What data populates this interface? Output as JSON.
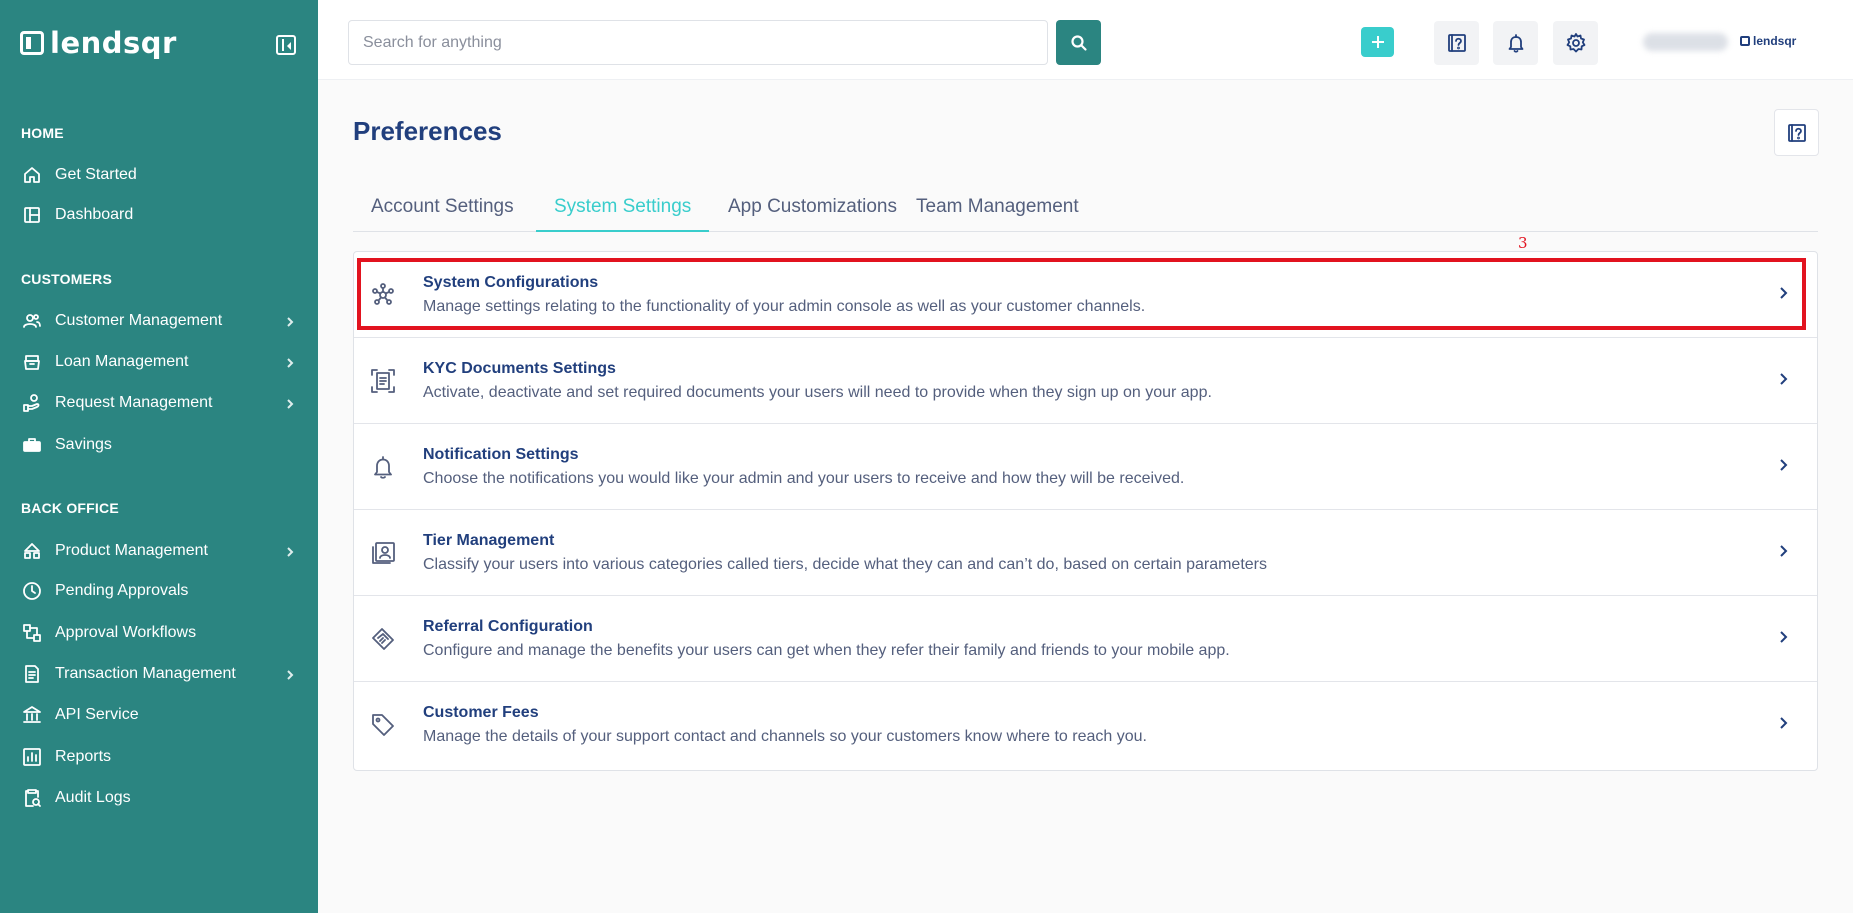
{
  "app": {
    "name": "lendsqr"
  },
  "sidebar": {
    "sections": [
      {
        "title": "HOME"
      },
      {
        "title": "CUSTOMERS"
      },
      {
        "title": "BACK OFFICE"
      }
    ],
    "items": [
      {
        "label": "Get Started",
        "icon": "home-icon"
      },
      {
        "label": "Dashboard",
        "icon": "dashboard-icon"
      },
      {
        "label": "Customer Management",
        "icon": "users-icon",
        "has_submenu": true
      },
      {
        "label": "Loan Management",
        "icon": "bank-icon",
        "has_submenu": true
      },
      {
        "label": "Request Management",
        "icon": "hand-money-icon",
        "has_submenu": true
      },
      {
        "label": "Savings",
        "icon": "briefcase-icon"
      },
      {
        "label": "Product Management",
        "icon": "product-icon",
        "has_submenu": true
      },
      {
        "label": "Pending Approvals",
        "icon": "clock-icon"
      },
      {
        "label": "Approval Workflows",
        "icon": "workflow-icon"
      },
      {
        "label": "Transaction Management",
        "icon": "transaction-icon",
        "has_submenu": true
      },
      {
        "label": "API Service",
        "icon": "bank-building-icon"
      },
      {
        "label": "Reports",
        "icon": "chart-icon"
      },
      {
        "label": "Audit Logs",
        "icon": "clipboard-search-icon"
      }
    ]
  },
  "topbar": {
    "search_placeholder": "Search for anything",
    "user_logo_text": "lendsqr"
  },
  "page": {
    "title": "Preferences",
    "tabs": [
      {
        "label": "Account Settings",
        "active": false
      },
      {
        "label": "System Settings",
        "active": true
      },
      {
        "label": "App Customizations",
        "active": false
      },
      {
        "label": "Team Management",
        "active": false
      }
    ],
    "settings": [
      {
        "title": "System Configurations",
        "description": "Manage settings relating to the functionality of your admin console as well as your customer channels.",
        "icon": "network-icon"
      },
      {
        "title": "KYC Documents Settings",
        "description": "Activate, deactivate and set required documents your users will need to provide when they sign up on your app.",
        "icon": "document-scan-icon"
      },
      {
        "title": "Notification Settings",
        "description": "Choose the notifications you would like your admin and your users to receive and how they will be received.",
        "icon": "bell-icon"
      },
      {
        "title": "Tier Management",
        "description": "Classify your users into various categories called tiers, decide what they can and can’t do, based on certain parameters",
        "icon": "user-card-icon"
      },
      {
        "title": "Referral Configuration",
        "description": "Configure and manage the benefits your users can get when they refer their family and friends to your mobile app.",
        "icon": "handshake-icon"
      },
      {
        "title": "Customer Fees",
        "description": "Manage the details of your support contact and channels so your customers know where to reach you.",
        "icon": "tag-icon"
      }
    ]
  },
  "annotation": {
    "marker_label": "3"
  },
  "colors": {
    "sidebar_bg": "#2b8581",
    "accent": "#39cdcc",
    "navy": "#213f7d",
    "highlight": "#e2131f"
  }
}
